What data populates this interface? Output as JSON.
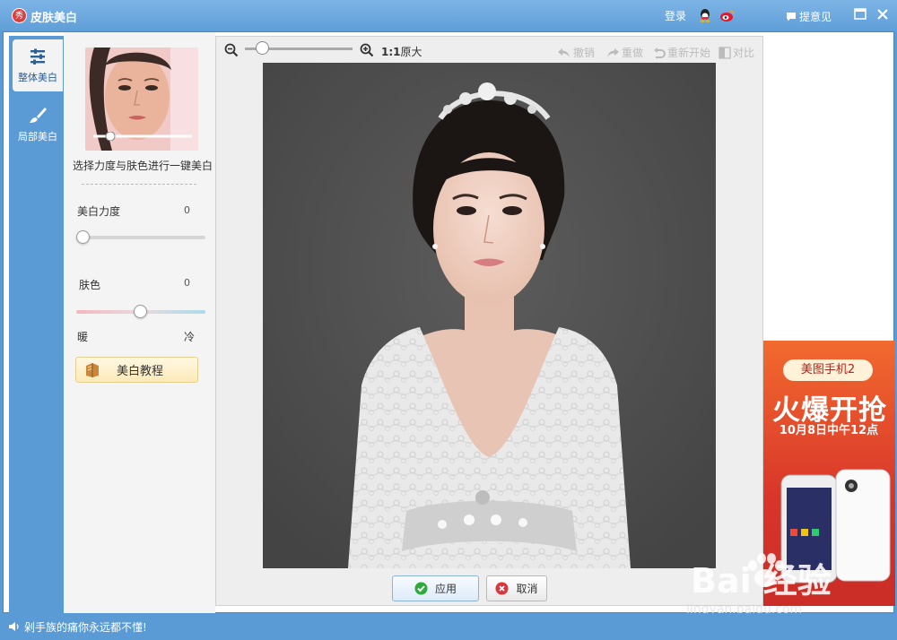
{
  "window": {
    "title": "皮肤美白",
    "logo_char": "秀",
    "login": "登录",
    "feedback": "提意见"
  },
  "tabs": [
    {
      "label": "整体美白",
      "icon": "sliders-icon"
    },
    {
      "label": "局部美白",
      "icon": "brush-icon"
    }
  ],
  "panel": {
    "preview_hint": "选择力度与肤色进行一键美白",
    "whitening_label": "美白力度",
    "whitening_value": "0",
    "skin_label": "肤色",
    "skin_value": "0",
    "warm_label": "暖",
    "cool_label": "冷",
    "tutorial_label": "美白教程",
    "whitening_level": 0,
    "skin_tone_level": 0.5
  },
  "toolbar": {
    "ratio_bold": "1:1",
    "ratio_text": "原大",
    "undo": "撤销",
    "redo": "重做",
    "restart": "重新开始",
    "compare": "对比"
  },
  "actions": {
    "apply": "应用",
    "cancel": "取消"
  },
  "ad": {
    "pill": "美图手机2",
    "headline": "火爆开抢",
    "date": "10月8日中午12点"
  },
  "status": {
    "message": "剁手族的痛你永远都不懂!"
  },
  "watermark": {
    "text": "Bai  经验",
    "url": "jingyan.baidu.com"
  },
  "colors": {
    "frame_blue": "#5b9bd5",
    "ad_red": "#d8352a",
    "apply_check": "#2eaa3a",
    "cancel_x": "#d9363e"
  }
}
